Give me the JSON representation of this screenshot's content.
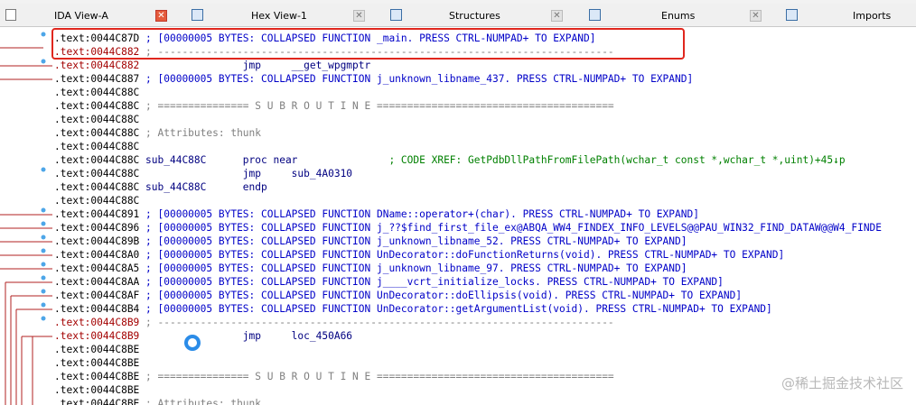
{
  "tabs": [
    {
      "label": "IDA View-A",
      "active": true
    },
    {
      "label": "Hex View-1",
      "active": false
    },
    {
      "label": "Structures",
      "active": false
    },
    {
      "label": "Enums",
      "active": false
    },
    {
      "label": "Imports",
      "active": false
    }
  ],
  "colors": {
    "address": "#000000",
    "address_highlight": "#a30000",
    "code": "#000080",
    "comment": "#808080",
    "xref_comment": "#008000",
    "collapsed": "#0000c8",
    "flow_arrow": "#b22222",
    "highlight_box": "#e0271e"
  },
  "listing": [
    {
      "address": ".text:0044C87D",
      "text": " ; [00000005 BYTES: COLLAPSED FUNCTION _main. PRESS CTRL-NUMPAD+ TO EXPAND]"
    },
    {
      "address": ".text:0044C882",
      "text": " ; ---------------------------------------------------------------------------"
    },
    {
      "address": ".text:0044C882",
      "text": "                 jmp     __get_wpgmptr"
    },
    {
      "address": ".text:0044C887",
      "text": " ; [00000005 BYTES: COLLAPSED FUNCTION j_unknown_libname_437. PRESS CTRL-NUMPAD+ TO EXPAND]"
    },
    {
      "address": ".text:0044C88C",
      "text": ""
    },
    {
      "address": ".text:0044C88C",
      "text": " ; =============== S U B R O U T I N E ======================================="
    },
    {
      "address": ".text:0044C88C",
      "text": ""
    },
    {
      "address": ".text:0044C88C",
      "text": " ; Attributes: thunk"
    },
    {
      "address": ".text:0044C88C",
      "text": ""
    },
    {
      "address": ".text:0044C88C",
      "text": " sub_44C88C      proc near               ; CODE XREF: GetPdbDllPathFromFilePath(wchar_t const *,wchar_t *,uint)+45↓p"
    },
    {
      "address": ".text:0044C88C",
      "text": "                 jmp     sub_4A0310"
    },
    {
      "address": ".text:0044C88C",
      "text": " sub_44C88C      endp"
    },
    {
      "address": ".text:0044C88C",
      "text": ""
    },
    {
      "address": ".text:0044C891",
      "text": " ; [00000005 BYTES: COLLAPSED FUNCTION DName::operator+(char). PRESS CTRL-NUMPAD+ TO EXPAND]"
    },
    {
      "address": ".text:0044C896",
      "text": " ; [00000005 BYTES: COLLAPSED FUNCTION j_??$find_first_file_ex@ABQA_WW4_FINDEX_INFO_LEVELS@@PAU_WIN32_FIND_DATAW@@W4_FINDE"
    },
    {
      "address": ".text:0044C89B",
      "text": " ; [00000005 BYTES: COLLAPSED FUNCTION j_unknown_libname_52. PRESS CTRL-NUMPAD+ TO EXPAND]"
    },
    {
      "address": ".text:0044C8A0",
      "text": " ; [00000005 BYTES: COLLAPSED FUNCTION UnDecorator::doFunctionReturns(void). PRESS CTRL-NUMPAD+ TO EXPAND]"
    },
    {
      "address": ".text:0044C8A5",
      "text": " ; [00000005 BYTES: COLLAPSED FUNCTION j_unknown_libname_97. PRESS CTRL-NUMPAD+ TO EXPAND]"
    },
    {
      "address": ".text:0044C8AA",
      "text": " ; [00000005 BYTES: COLLAPSED FUNCTION j____vcrt_initialize_locks. PRESS CTRL-NUMPAD+ TO EXPAND]"
    },
    {
      "address": ".text:0044C8AF",
      "text": " ; [00000005 BYTES: COLLAPSED FUNCTION UnDecorator::doEllipsis(void). PRESS CTRL-NUMPAD+ TO EXPAND]"
    },
    {
      "address": ".text:0044C8B4",
      "text": " ; [00000005 BYTES: COLLAPSED FUNCTION UnDecorator::getArgumentList(void). PRESS CTRL-NUMPAD+ TO EXPAND]"
    },
    {
      "address": ".text:0044C8B9",
      "text": " ; ---------------------------------------------------------------------------"
    },
    {
      "address": ".text:0044C8B9",
      "text": "                 jmp     loc_450A66"
    },
    {
      "address": ".text:0044C8BE",
      "text": ""
    },
    {
      "address": ".text:0044C8BE",
      "text": ""
    },
    {
      "address": ".text:0044C8BE",
      "text": " ; =============== S U B R O U T I N E ======================================="
    },
    {
      "address": ".text:0044C8BE",
      "text": ""
    },
    {
      "address": ".text:0044C8BE",
      "text": " ; Attributes: thunk"
    },
    {
      "address": ".text:0044C8BE",
      "text": ""
    }
  ],
  "watermark": "@稀土掘金技术社区"
}
